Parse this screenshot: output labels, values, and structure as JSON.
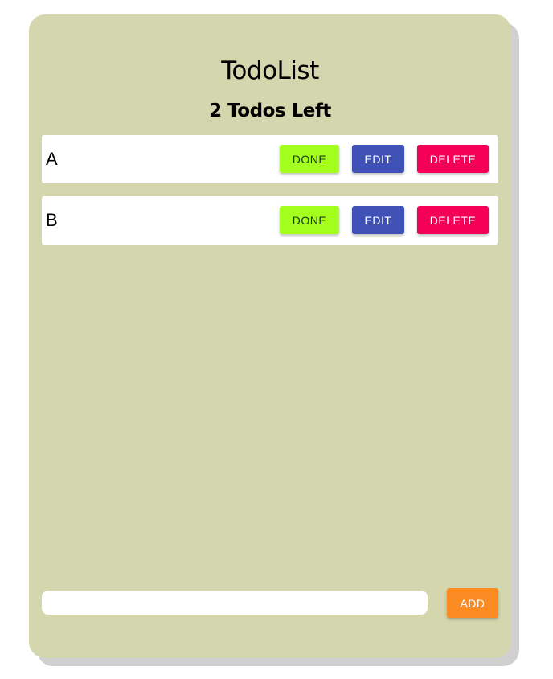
{
  "app": {
    "title": "TodoList",
    "remaining": "2 Todos Left"
  },
  "todos": [
    {
      "text": "A",
      "done_label": "DONE",
      "edit_label": "EDIT",
      "delete_label": "DELETE"
    },
    {
      "text": "B",
      "done_label": "DONE",
      "edit_label": "EDIT",
      "delete_label": "DELETE"
    }
  ],
  "add": {
    "value": "",
    "button_label": "ADD"
  },
  "colors": {
    "card_bg": "#d4d6ae",
    "done": "#a4ff1e",
    "edit": "#3f51b5",
    "delete": "#f50057",
    "add": "#fb8c24"
  }
}
